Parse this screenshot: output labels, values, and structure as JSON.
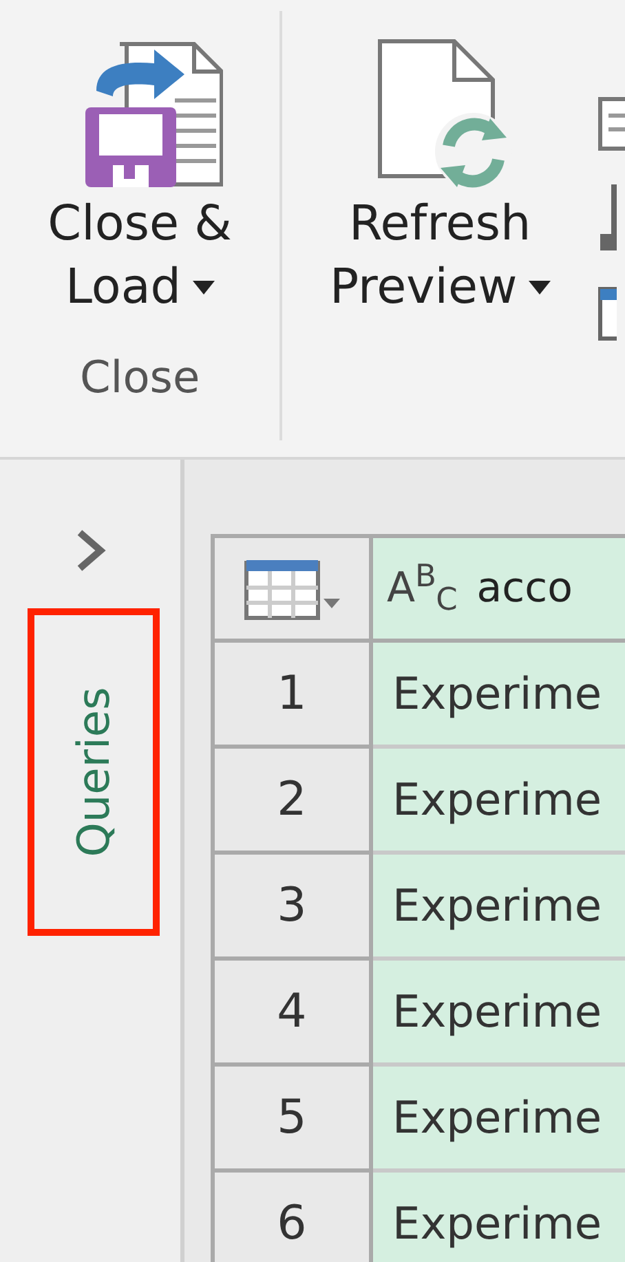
{
  "ribbon": {
    "groups": [
      {
        "label": "Close",
        "buttons": [
          {
            "kind": "close-load",
            "label_lines": [
              "Close &",
              "Load"
            ],
            "dropdown": true
          }
        ]
      },
      {
        "buttons": [
          {
            "kind": "refresh",
            "label_lines": [
              "Refresh",
              "Preview"
            ],
            "dropdown": true
          }
        ]
      }
    ]
  },
  "queries_pane": {
    "collapsed": true,
    "label": "Queries",
    "highlighted": true
  },
  "table": {
    "columns": [
      {
        "type_label": "A$^{B}$$_{C}$",
        "name": "acco"
      }
    ],
    "rows": [
      {
        "index": "1",
        "cells": [
          "Experime"
        ]
      },
      {
        "index": "2",
        "cells": [
          "Experime"
        ]
      },
      {
        "index": "3",
        "cells": [
          "Experime"
        ]
      },
      {
        "index": "4",
        "cells": [
          "Experime"
        ]
      },
      {
        "index": "5",
        "cells": [
          "Experime"
        ]
      },
      {
        "index": "6",
        "cells": [
          "Experime"
        ]
      }
    ]
  }
}
